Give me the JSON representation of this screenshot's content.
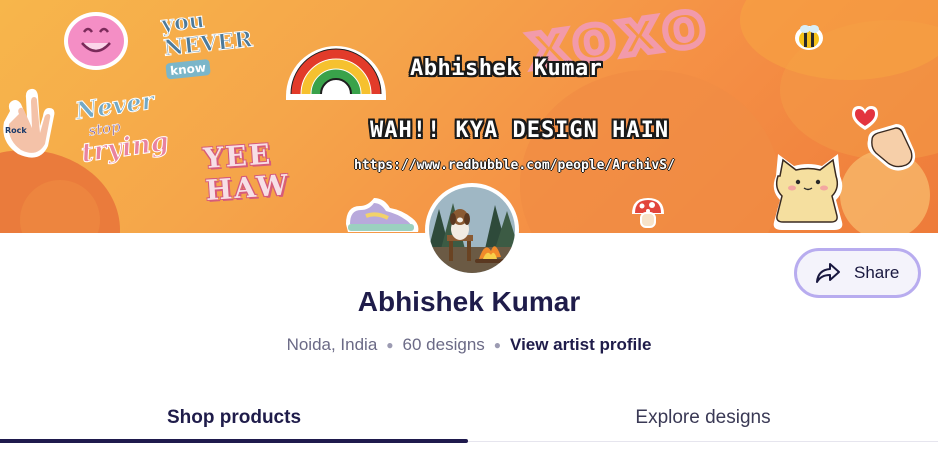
{
  "banner": {
    "title": "Abhishek Kumar",
    "tagline": "WAH!! KYA DESIGN HAIN",
    "url": "https://www.redbubble.com/people/ArchivS/",
    "stickers": {
      "never_know_1": "you",
      "never_know_2": "NEVER",
      "never_know_3": "know",
      "never_stop_1": "Never",
      "never_stop_2": "stop",
      "never_stop_3": "trying",
      "yeehaw_1": "YEE",
      "yeehaw_2": "HAW",
      "xoxo": "xoxo",
      "rock": "Rock"
    },
    "colors": {
      "banner_start": "#f7b64b",
      "banner_end": "#ee7b3a"
    }
  },
  "avatar": {
    "icon": "avatar-dog-campfire"
  },
  "share": {
    "label": "Share",
    "icon": "share-arrow-icon"
  },
  "profile": {
    "name": "Abhishek Kumar",
    "location": "Noida, India",
    "designs": "60 designs",
    "artist_link": "View artist profile"
  },
  "tabs": [
    {
      "label": "Shop products",
      "active": true
    },
    {
      "label": "Explore designs",
      "active": false
    }
  ],
  "theme": {
    "accent": "#1f1c4a",
    "share_border": "#b8acef"
  }
}
